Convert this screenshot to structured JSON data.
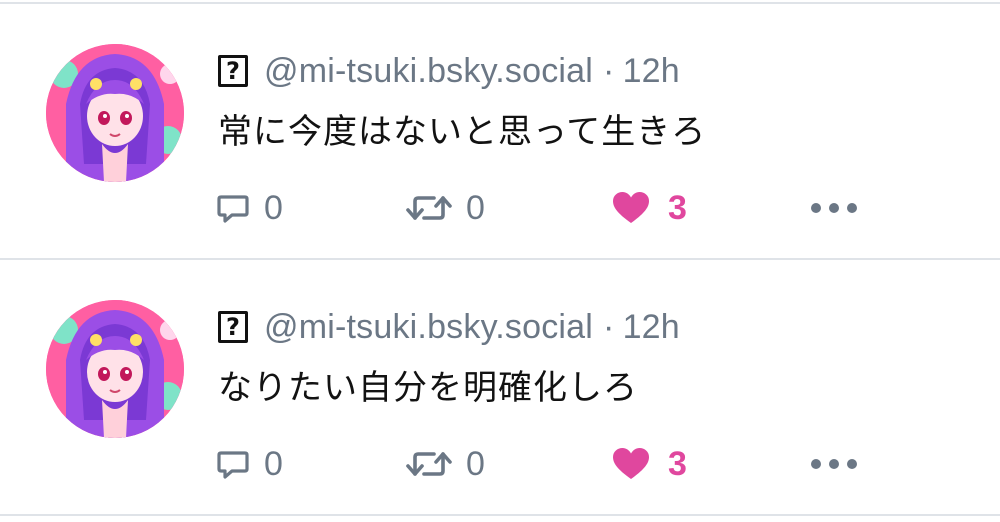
{
  "colors": {
    "muted": "#6b7785",
    "like": "#e0479e",
    "divider": "#dfe3e8",
    "text": "#121212"
  },
  "posts": [
    {
      "avatar_icon": "anime-character-avatar",
      "unknown_glyph": "?",
      "handle": "@mi-tsuki.bsky.social",
      "separator": "·",
      "time": "12h",
      "text": "常に今度はないと思って生きろ",
      "reply_icon": "speech-bubble-icon",
      "reply_count": "0",
      "repost_icon": "repost-arrows-icon",
      "repost_count": "0",
      "like_icon": "heart-icon",
      "like_count": "3",
      "more_icon": "ellipsis-icon"
    },
    {
      "avatar_icon": "anime-character-avatar",
      "unknown_glyph": "?",
      "handle": "@mi-tsuki.bsky.social",
      "separator": "·",
      "time": "12h",
      "text": "なりたい自分を明確化しろ",
      "reply_icon": "speech-bubble-icon",
      "reply_count": "0",
      "repost_icon": "repost-arrows-icon",
      "repost_count": "0",
      "like_icon": "heart-icon",
      "like_count": "3",
      "more_icon": "ellipsis-icon"
    }
  ]
}
